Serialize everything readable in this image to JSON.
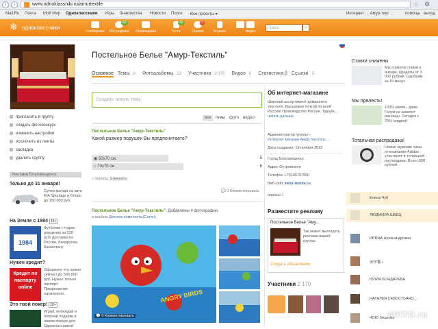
{
  "browser": {
    "url": "www.odnoklassniki.ru/amurtextile"
  },
  "topbar": {
    "items": [
      "Mail.Ru",
      "Почта",
      "Мой Мир",
      "Одноклассники",
      "Игры",
      "Знакомства",
      "Новости",
      "Поиск",
      "Все проекты ▾"
    ],
    "right": [
      "Интернет ... Амур-текс ...",
      "помощь",
      "выход"
    ]
  },
  "toolbar": {
    "logo": "одноклассники",
    "items": [
      {
        "label": "Сообщения",
        "badge": ""
      },
      {
        "label": "Обсуждения",
        "badge": "40"
      },
      {
        "label": "Оповещения",
        "badge": ""
      },
      {
        "label": "Гости",
        "badge": "40"
      },
      {
        "label": "Оценки",
        "badge": "5"
      },
      {
        "label": "Музыка",
        "badge": ""
      },
      {
        "label": "Видео",
        "badge": ""
      }
    ],
    "search_placeholder": "Поиск"
  },
  "left_menu": [
    "пригласить в группу",
    "создать фотоконкурс",
    "изменить настройки",
    "исключить из ленты",
    "закладка",
    "удалить группу"
  ],
  "ads": {
    "bar": "Реклама  Благовещенск",
    "items": [
      {
        "head": "Только до 31 января!",
        "text": "Супер выгода на авто KIA Sportage и Cerato до 150 000 руб."
      },
      {
        "head": "На Земле с 1984",
        "age": "16+",
        "img_text": "1984",
        "text": "Футболки с годом рождения за 530 руб! Доставка по России, Беларусии, Казахстану"
      },
      {
        "head": "Нужен кредит?",
        "img_text": "Кредит по паспорту online",
        "text": "Оформите его прямо сейчас! До 500 000 руб. Нужен только паспорт. Предложение ограничено."
      },
      {
        "head": "Это твой покер!",
        "age": "18+",
        "text": "Играй, побеждай и получай подарки в новом покере для Одноклассников!"
      }
    ]
  },
  "group": {
    "title": "Постельное Белье \"Амур-Текстиль\"",
    "tabs": [
      {
        "label": "Основное",
        "count": "",
        "active": true
      },
      {
        "label": "Темы",
        "count": "6"
      },
      {
        "label": "Фотоальбомы",
        "count": "13"
      },
      {
        "label": "Участники",
        "count": "2 170"
      },
      {
        "label": "Видео",
        "count": "0"
      },
      {
        "label": "Статистика β",
        "count": ""
      },
      {
        "label": "Ссылки",
        "count": "0"
      }
    ],
    "new_topic_placeholder": "Создать новую тему",
    "filters": [
      "все",
      "темы",
      "фото",
      "видео"
    ]
  },
  "poll_post": {
    "author": "Постельное Белье \"Амур-Текстиль\"",
    "question": "Какой размер подушек Вы предпочитаете?",
    "options": [
      {
        "label": "50x70 см.",
        "count": "5",
        "share": 0.45
      },
      {
        "label": "70x70 см.",
        "count": "6",
        "share": 0.54
      }
    ],
    "footer": "опросы",
    "footer_action": "изменить",
    "comments": "0 Комментировать"
  },
  "photo_post": {
    "author": "Постельное Белье \"Амур-Текстиль\"",
    "text": "Добавлены 4 фотографии",
    "album_prefix": "в альбом ",
    "album": "Детские комплекты(Сатин)",
    "comments": "0 Комментировать",
    "image_text": "ANGRY BIRDS"
  },
  "about": {
    "title": "Об интернет-магазине",
    "desc": "Широкий ассортимент домашнего текстиля. Высылаем почтой по всей России! Производство Россия, Турция,...",
    "more": "читать дальше",
    "admins_label": "Администратор группы –",
    "admins": "Интернет магазин Амур-текстиль ...",
    "created": "Дата создания: 19 ноября 2012",
    "city": "Город Благовещенск",
    "address": "Адрес Островского",
    "phone": "Телефон +79145797950",
    "website_label": "Веб-сайт",
    "website": "amur-textile.ru",
    "polls": "опросы",
    "polls_count": "2"
  },
  "place_ad": {
    "title": "Разместите рекламу",
    "card_title": "Постельное Белье \"Аму...",
    "card_text": "Так может выглядеть реклама вашей группы",
    "button": "Создать объявление"
  },
  "members": {
    "label": "Участники",
    "count": "2 170"
  },
  "sidebar": {
    "blocks": [
      {
        "title": "Ставки снижены",
        "text": "Мы снизили ставки в январе. Кредиты от 3 000 рублей. Одобрим за 15 минут."
      },
      {
        "title": "Мы прелесть!",
        "text": "100% копия - даже Голум не заметит разницы. Сегодня с 75% скидкой"
      },
      {
        "title": "Тотальная распродажа!",
        "text": "Новые мужские часы от компании Adidas участвуют в тотальной распродаже. Всего 890 рублей."
      }
    ]
  },
  "friends": [
    "Елена Чуб",
    "ЛЮДМИЛА ШВЕЦ",
    "ИРИНА Александровна",
    "沃尔鲁 •",
    "ЮЛИЯ БОНДАРЕВА",
    "НАТАЛЬЯ СЕВОСТЬЯНО...",
    "•ЮЮ Гищенко"
  ],
  "watermark": "AVITO.ru"
}
